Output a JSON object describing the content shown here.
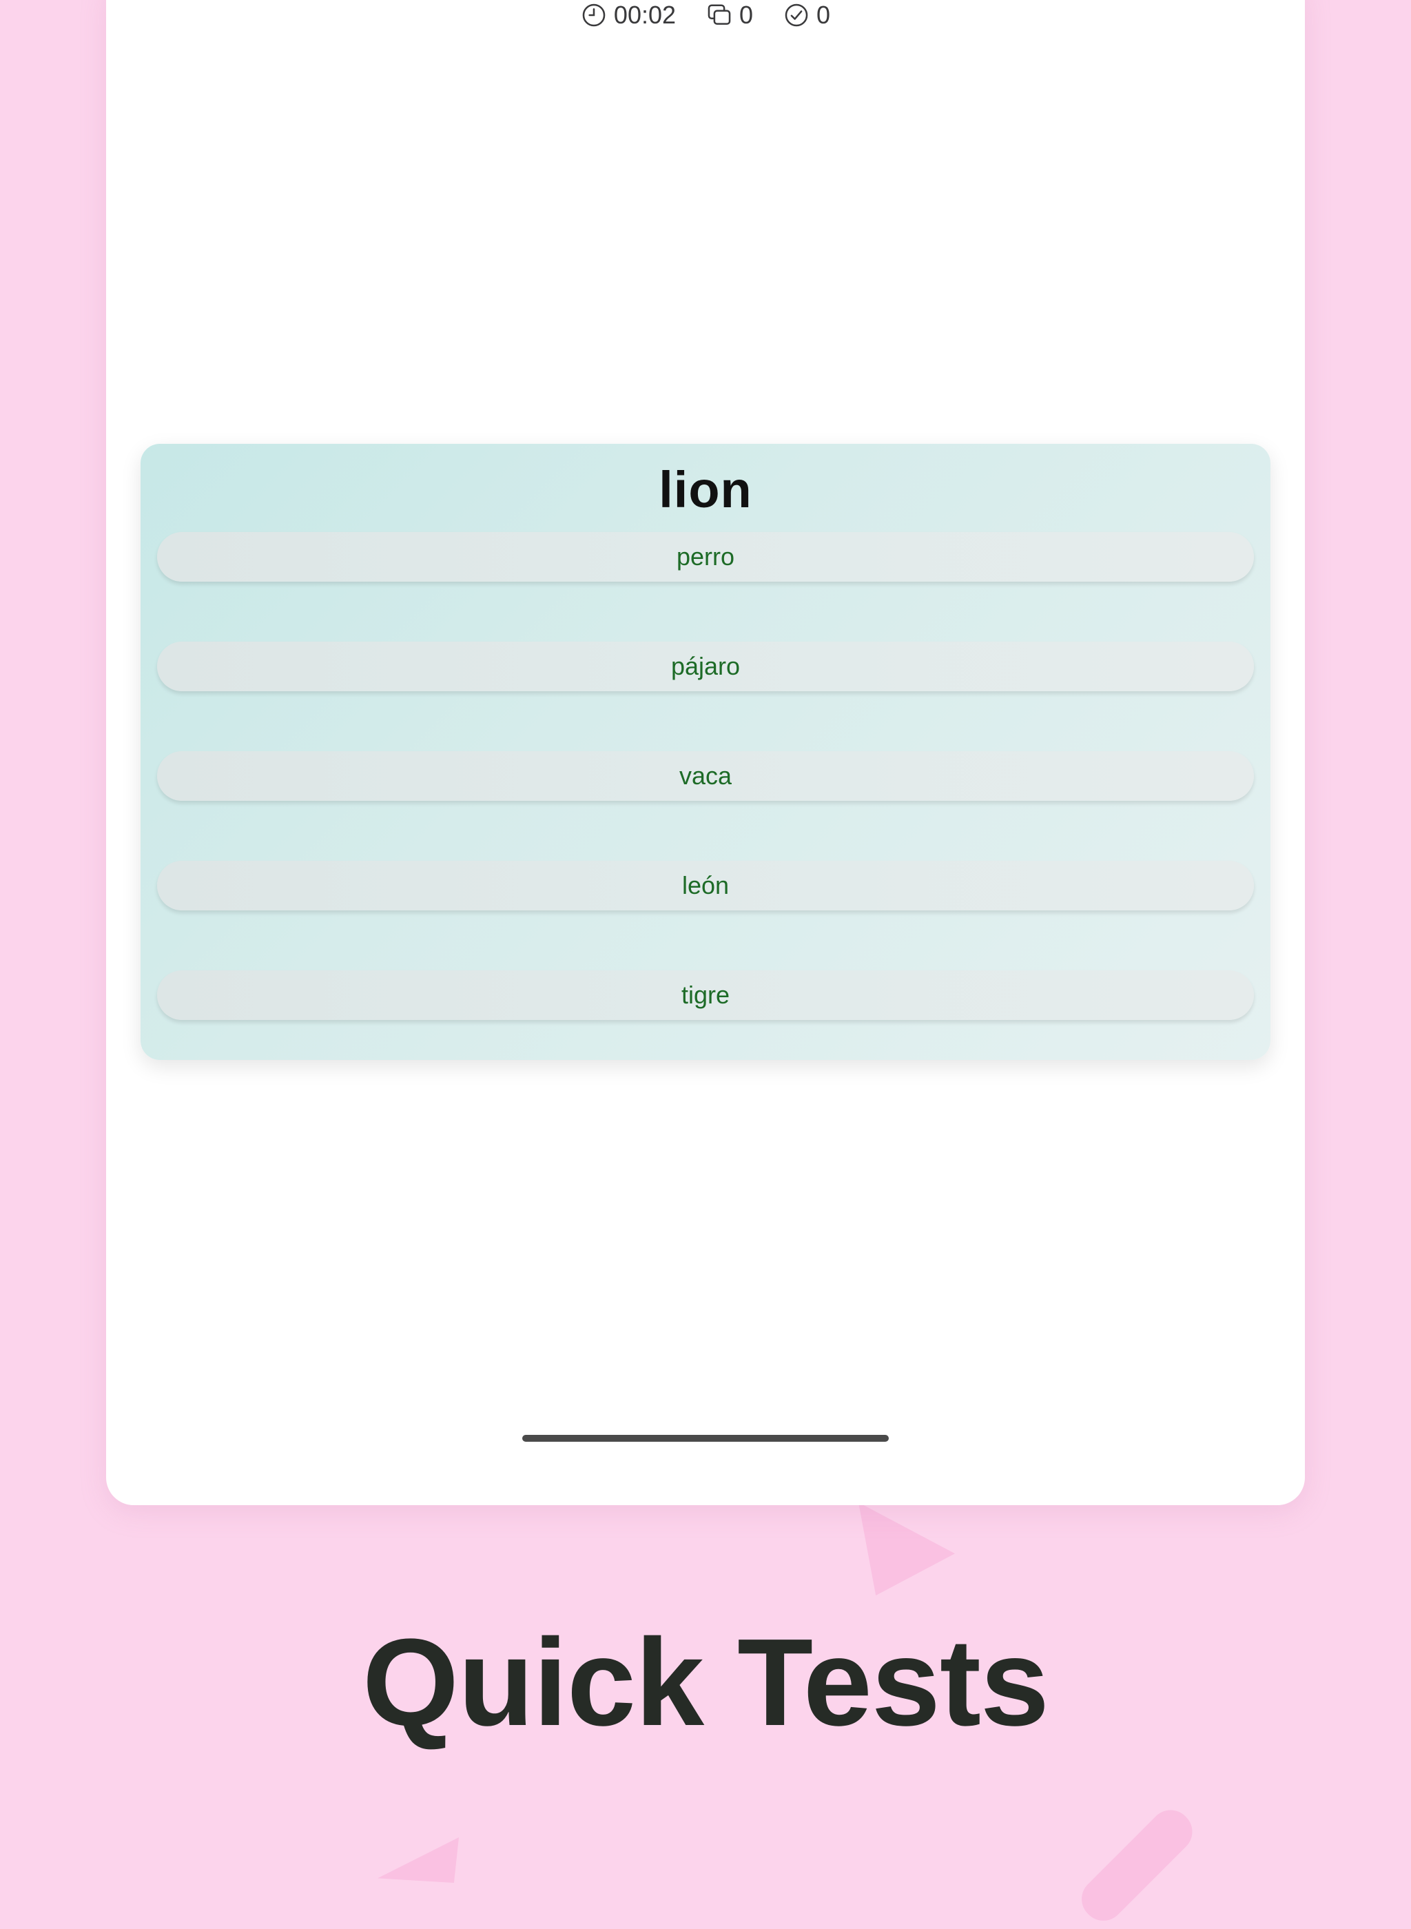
{
  "stats": {
    "time": "00:02",
    "cards_count": "0",
    "correct_count": "0"
  },
  "quiz": {
    "question": "lion",
    "options": [
      {
        "label": "perro"
      },
      {
        "label": "pájaro"
      },
      {
        "label": "vaca"
      },
      {
        "label": "león"
      },
      {
        "label": "tigre"
      }
    ]
  },
  "headline": "Quick Tests",
  "colors": {
    "background": "#fcd4ec",
    "card_teal": "#c7e8e7",
    "option_text": "#1d6b27",
    "headline_text": "#262b26"
  },
  "icons": {
    "timer": "clock-icon",
    "cards": "cards-icon",
    "correct": "checkmark-circle-icon"
  }
}
